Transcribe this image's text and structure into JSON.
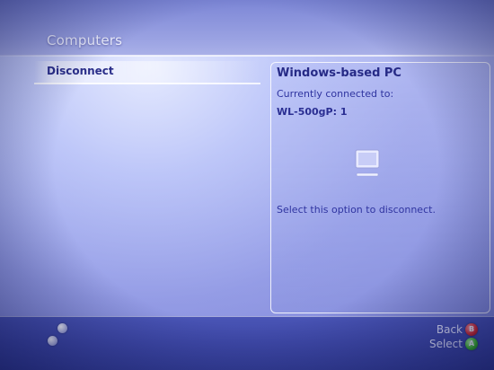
{
  "header": {
    "title": "Computers"
  },
  "menu": {
    "items": [
      {
        "label": "Disconnect"
      }
    ]
  },
  "details": {
    "title": "Windows-based PC",
    "connected_label": "Currently connected to:",
    "connected_value": "WL-500gP: 1",
    "icon": "computer-monitor-icon",
    "description": "Select this option to disconnect."
  },
  "footer": {
    "back_label": "Back",
    "back_button_glyph": "B",
    "back_button_color": "#e02a2a",
    "select_label": "Select",
    "select_button_glyph": "A",
    "select_button_color": "#3cc21e"
  }
}
